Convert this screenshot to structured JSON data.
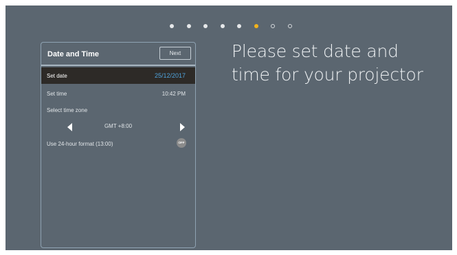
{
  "progress": {
    "total_steps": 8,
    "current_step": 6,
    "colors": {
      "done": "#e6e8ea",
      "current": "#f2b21b",
      "todo": "#d6dadd"
    }
  },
  "panel": {
    "title": "Date and Time",
    "next_label": "Next",
    "set_date": {
      "label": "Set date",
      "value": "25/12/2017"
    },
    "set_time": {
      "label": "Set time",
      "value": "10:42 PM"
    },
    "time_zone": {
      "label": "Select time zone",
      "value": "GMT +8:00"
    },
    "format_24h": {
      "label": "Use 24-hour format (13:00)",
      "state": "OFF"
    }
  },
  "headline": {
    "line1": "Please set date and",
    "line2": "time for your projector"
  },
  "colors": {
    "background": "#5b6670",
    "selected_row": "#2d2a27",
    "selected_value": "#4fa3dc",
    "accent": "#f2b21b"
  }
}
